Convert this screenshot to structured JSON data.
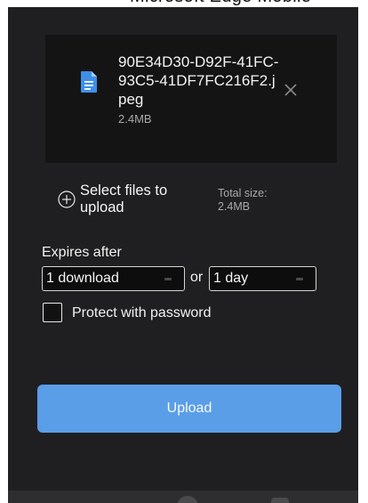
{
  "top_text": "Microsoft Edge Mobile",
  "file": {
    "name": "90E34D30-D92F-41FC-93C5-41DF7FC216F2.jpeg",
    "size": "2.4MB",
    "icon": "document-icon",
    "remove_icon": "close-icon"
  },
  "select_files": {
    "label": "Select files to upload",
    "icon": "plus-circle-icon"
  },
  "total": {
    "label": "Total size:",
    "value": "2.4MB"
  },
  "expires": {
    "label": "Expires after",
    "downloads_value": "1 download",
    "or_label": "or",
    "days_value": "1 day"
  },
  "password": {
    "label": "Protect with password",
    "checked": false
  },
  "upload": {
    "label": "Upload",
    "color": "#5a9ee8"
  },
  "colors": {
    "panel": "#1f1f21",
    "card": "#141414",
    "accent": "#5a9ee8"
  }
}
